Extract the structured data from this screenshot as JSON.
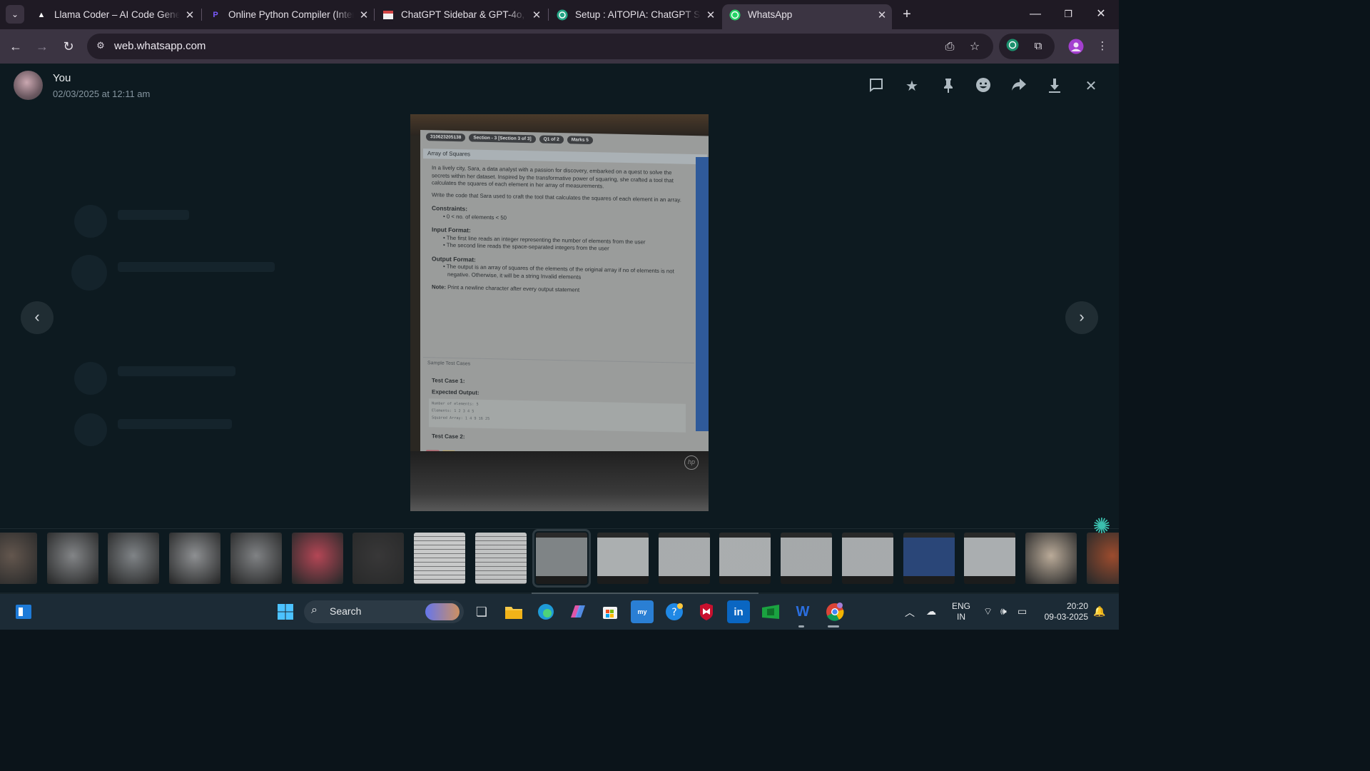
{
  "browser": {
    "tabs": [
      {
        "title": "Llama Coder – AI Code Generat",
        "favicon": "llama-triangle-icon"
      },
      {
        "title": "Online Python Compiler (Interp",
        "favicon": "programiz-icon"
      },
      {
        "title": "ChatGPT Sidebar & GPT-4o, o1",
        "favicon": "sidebar-icon"
      },
      {
        "title": "Setup : AITOPIA: ChatGPT Sideb",
        "favicon": "chatgpt-icon"
      },
      {
        "title": "WhatsApp",
        "favicon": "whatsapp-icon"
      }
    ],
    "active_tab": 4,
    "address": "web.whatsapp.com",
    "colors": {
      "tabbar": "#1f1a24",
      "toolbar": "#3b3442",
      "accent_whatsapp": "#25d366"
    }
  },
  "viewer": {
    "sender": "You",
    "timestamp": "02/03/2025 at 12:11 am",
    "header_icons": [
      "reply-icon",
      "star-icon",
      "pin-icon",
      "emoji-icon",
      "forward-icon",
      "download-icon",
      "close-icon"
    ],
    "photo": {
      "pills": [
        "310623205138",
        "Section - 3 [Section 3 of 3]",
        "Q1 of 2",
        "Marks 5"
      ],
      "question_title": "Array of Squares",
      "intro": "In a lively city, Sara, a data analyst with a passion for discovery, embarked on a quest to solve the secrets within her dataset. Inspired by the transformative power of squaring, she crafted a tool that calculates the squares of each element in her array of measurements.",
      "task": "Write the code that Sara used to craft the tool that calculates the squares of each element in an array.",
      "constraints_heading": "Constraints:",
      "constraints": [
        "0 < no. of elements < 50"
      ],
      "input_heading": "Input Format:",
      "input_items": [
        "The first line reads an integer representing the number of elements from the user",
        "The second line reads the space-separated integers from the user"
      ],
      "output_heading": "Output Format:",
      "output_items": [
        "The output is an array of squares of the elements of the original array if no of elements is not negative. Otherwise, it will be a string Invalid elements"
      ],
      "note_label": "Note:",
      "note": "Print a newline character after every output statement",
      "samples_label": "Sample Test Cases",
      "tc1": "Test Case 1:",
      "expected": "Expected Output:",
      "code_lines": [
        "Number of elements: 5",
        "Elements: 1 2 3 4 5",
        "Squared Array: 1 4 9 16 25"
      ],
      "tc2": "Test Case 2:",
      "brand": "hp"
    }
  },
  "thumbnails": [
    {
      "kind": "photo",
      "color": "#6b5c52"
    },
    {
      "kind": "photo",
      "color": "#8d8e90"
    },
    {
      "kind": "photo",
      "color": "#8a8d90"
    },
    {
      "kind": "photo",
      "color": "#999a9c"
    },
    {
      "kind": "photo",
      "color": "#8a8b8d"
    },
    {
      "kind": "photo",
      "color": "#c24a5a"
    },
    {
      "kind": "photo",
      "color": "#3c3a3a"
    },
    {
      "kind": "document",
      "color": "#d8d8d8"
    },
    {
      "kind": "document",
      "color": "#d0d0d0"
    },
    {
      "kind": "screen",
      "color": "#7f8486",
      "selected": true
    },
    {
      "kind": "screen",
      "color": "#b9bcbd"
    },
    {
      "kind": "screen",
      "color": "#b5b8b9"
    },
    {
      "kind": "screen",
      "color": "#b7babb"
    },
    {
      "kind": "screen",
      "color": "#b2b5b6"
    },
    {
      "kind": "screen",
      "color": "#b4b7b8"
    },
    {
      "kind": "screen",
      "color": "#2d4a80"
    },
    {
      "kind": "screen",
      "color": "#b8bbbc"
    },
    {
      "kind": "photo",
      "color": "#c9b7a3"
    },
    {
      "kind": "photo",
      "color": "#a8502f"
    }
  ],
  "taskbar": {
    "search_label": "Search",
    "lang_line1": "ENG",
    "lang_line2": "IN",
    "time": "20:20",
    "date": "09-03-2025",
    "apps": [
      "task-view-icon",
      "file-explorer-icon",
      "edge-icon",
      "copilot-icon",
      "store-icon",
      "mylic-icon",
      "help-icon",
      "mcafee-icon",
      "linkedin-icon",
      "spreadsheet-icon",
      "word-icon",
      "chrome-icon"
    ]
  }
}
